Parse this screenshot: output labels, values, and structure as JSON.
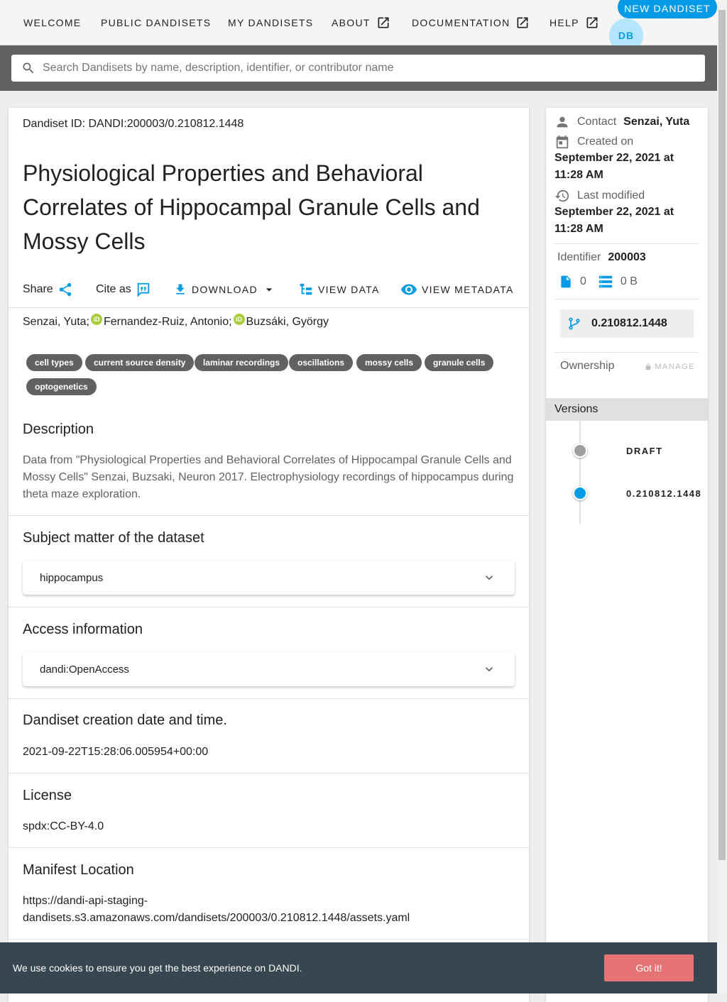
{
  "nav": {
    "items": [
      {
        "label": "WELCOME",
        "external": false
      },
      {
        "label": "PUBLIC DANDISETS",
        "external": false
      },
      {
        "label": "MY DANDISETS",
        "external": false
      },
      {
        "label": "ABOUT",
        "external": true
      },
      {
        "label": "DOCUMENTATION",
        "external": true
      },
      {
        "label": "HELP",
        "external": true
      }
    ],
    "new_dandiset_label": "NEW DANDISET",
    "avatar_initials": "DB"
  },
  "search": {
    "placeholder": "Search Dandisets by name, description, identifier, or contributor name",
    "value": ""
  },
  "dandiset": {
    "id_text": "Dandiset ID: DANDI:200003/0.210812.1448",
    "title": "Physiological Properties and Behavioral Correlates of Hippocampal Granule Cells and Mossy Cells",
    "actions": {
      "share": "Share",
      "cite": "Cite as",
      "download": "DOWNLOAD",
      "view_data": "VIEW DATA",
      "view_metadata": "VIEW METADATA"
    },
    "authors": [
      "Senzai, Yuta;",
      "Fernandez-Ruiz, Antonio;",
      "Buzsáki, György"
    ],
    "keywords": [
      "cell types",
      "current source density",
      "laminar recordings",
      "oscillations",
      "mossy cells",
      "granule cells",
      "optogenetics"
    ],
    "description_title": "Description",
    "description": "Data from \"Physiological Properties and Behavioral Correlates of Hippocampal Granule Cells and Mossy Cells\" Senzai, Buzsaki, Neuron 2017. Electrophysiology recordings of hippocampus during theta maze exploration.",
    "subject_title": "Subject matter of the dataset",
    "subject_value": "hippocampus",
    "access_title": "Access information",
    "access_value": "dandi:OpenAccess",
    "created_title": "Dandiset creation date and time.",
    "created_value": "2021-09-22T15:28:06.005954+00:00",
    "license_title": "License",
    "license_value": "spdx:CC-BY-4.0",
    "manifest_title": "Manifest Location",
    "manifest_line1": "https://dandi-api-staging-",
    "manifest_line2": "dandisets.s3.amazonaws.com/dandisets/200003/0.210812.1448/assets.yaml"
  },
  "sidebar": {
    "contact_label": "Contact",
    "contact_value": "Senzai, Yuta",
    "created_label": "Created on",
    "created_line1": "September 22, 2021 at",
    "created_line2": "11:28 AM",
    "modified_label": "Last modified",
    "modified_line1": "September 22, 2021 at",
    "modified_line2": "11:28 AM",
    "identifier_label": "Identifier",
    "identifier_value": "200003",
    "file_count": "0",
    "size": "0 B",
    "version": "0.210812.1448",
    "ownership_label": "Ownership",
    "manage_label": "MANAGE",
    "versions_header": "Versions",
    "versions": [
      {
        "label": "DRAFT",
        "color": "#9e9e9e"
      },
      {
        "label": "0.210812.1448",
        "color": "#039be5"
      }
    ]
  },
  "cookie": {
    "text": "We use cookies to ensure you get the best experience on DANDI.",
    "button": "Got it!"
  },
  "colors": {
    "accent": "#039be5",
    "chip": "#616161",
    "cookie_bg": "#37474f",
    "cookie_btn": "#e57373",
    "orcid": "#a6ce39"
  }
}
